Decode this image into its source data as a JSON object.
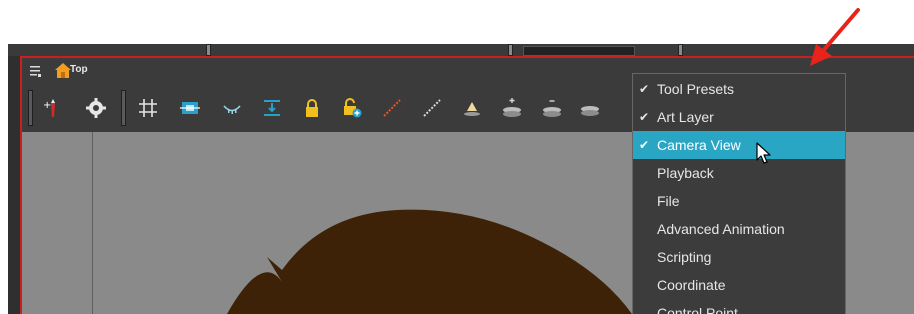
{
  "view": {
    "title": "Top",
    "frame_color": "#c8201c"
  },
  "toolbar": {
    "icons": [
      "add-tool-preset-icon",
      "gear-icon",
      "grid-icon",
      "fit-view-icon",
      "onion-skin-icon",
      "align-icon",
      "lock-icon",
      "lock-add-icon",
      "bone-red-icon",
      "bone-icon",
      "light-icon",
      "layer-up-icon",
      "layer-down-icon",
      "layer-stack-icon"
    ]
  },
  "menu": {
    "highlight_color": "#29a6c4",
    "items": [
      {
        "label": "Tool Presets",
        "checked": "✔"
      },
      {
        "label": "Art Layer",
        "checked": "✔"
      },
      {
        "label": "Camera View",
        "checked": "✔"
      },
      {
        "label": "Playback",
        "checked": ""
      },
      {
        "label": "File",
        "checked": ""
      },
      {
        "label": "Advanced Animation",
        "checked": ""
      },
      {
        "label": "Scripting",
        "checked": ""
      },
      {
        "label": "Coordinate",
        "checked": ""
      },
      {
        "label": "Control Point",
        "checked": ""
      }
    ]
  },
  "canvas": {
    "background": "#8a8a8a",
    "shape_color": "#3d2207"
  },
  "annotation": {
    "arrow_color": "#e8231c"
  }
}
